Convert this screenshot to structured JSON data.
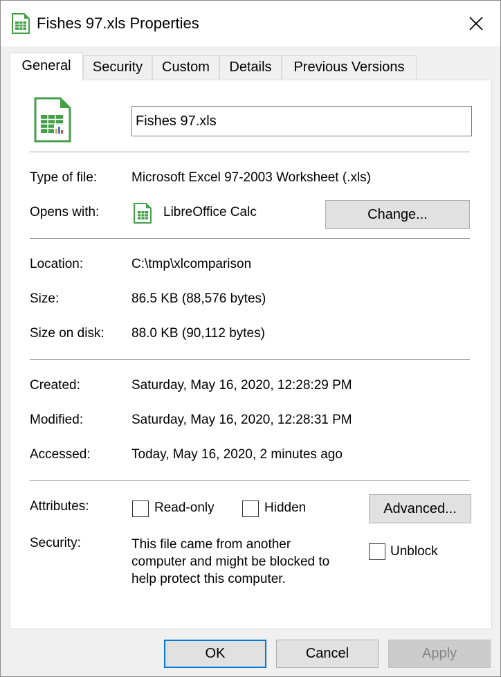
{
  "window": {
    "title": "Fishes 97.xls Properties"
  },
  "tabs": [
    {
      "label": "General",
      "active": true
    },
    {
      "label": "Security",
      "active": false
    },
    {
      "label": "Custom",
      "active": false
    },
    {
      "label": "Details",
      "active": false
    },
    {
      "label": "Previous Versions",
      "active": false
    }
  ],
  "general": {
    "file_name": "Fishes 97.xls",
    "type_label": "Type of file:",
    "type_value": "Microsoft Excel 97-2003 Worksheet (.xls)",
    "opens_label": "Opens with:",
    "opens_value": "LibreOffice Calc",
    "change_button": "Change...",
    "location_label": "Location:",
    "location_value": "C:\\tmp\\xlcomparison",
    "size_label": "Size:",
    "size_value": "86.5 KB (88,576 bytes)",
    "size_disk_label": "Size on disk:",
    "size_disk_value": "88.0 KB (90,112 bytes)",
    "created_label": "Created:",
    "created_value": "Saturday, May 16, 2020, 12:28:29 PM",
    "modified_label": "Modified:",
    "modified_value": "Saturday, May 16, 2020, 12:28:31 PM",
    "accessed_label": "Accessed:",
    "accessed_value": "Today, May 16, 2020, 2 minutes ago",
    "attributes_label": "Attributes:",
    "readonly_label": "Read-only",
    "readonly_checked": false,
    "hidden_label": "Hidden",
    "hidden_checked": false,
    "advanced_button": "Advanced...",
    "security_label": "Security:",
    "security_line1": "This file came from another",
    "security_line2": "computer and might be blocked to",
    "security_line3": "help protect this computer.",
    "unblock_label": "Unblock",
    "unblock_checked": false
  },
  "buttons": {
    "ok": "OK",
    "cancel": "Cancel",
    "apply": "Apply"
  },
  "colors": {
    "accent": "#0078d7",
    "calc_green": "#43a047"
  },
  "icons": {
    "file": "libreoffice-calc-file-icon",
    "close": "close-icon",
    "app": "libreoffice-calc-app-icon"
  }
}
